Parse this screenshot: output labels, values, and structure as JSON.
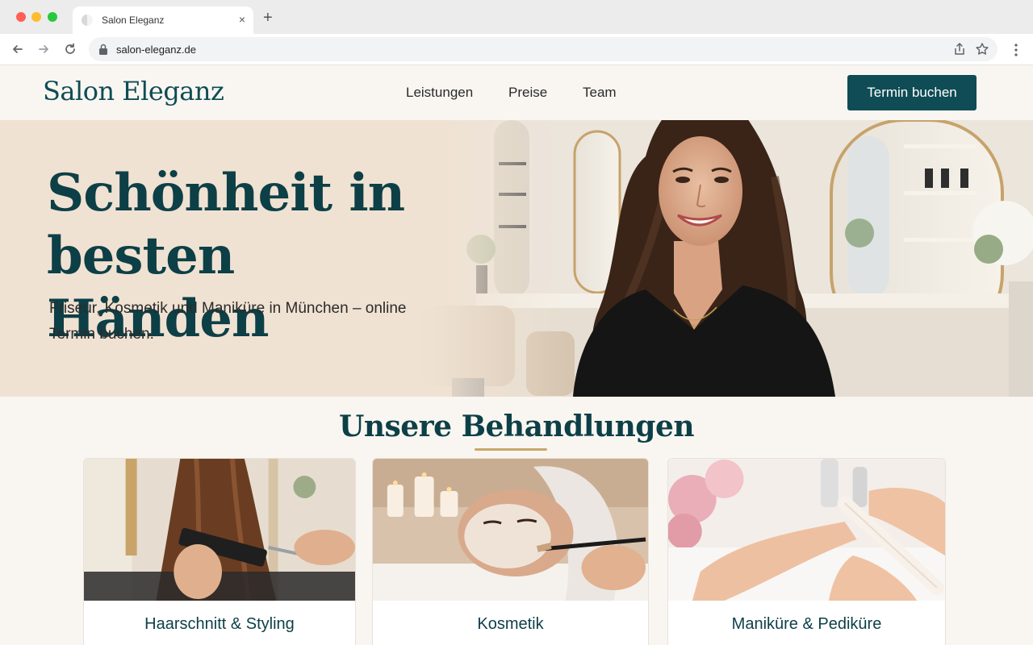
{
  "browser": {
    "tab_title": "Salon Eleganz",
    "tab_close": "×",
    "new_tab": "+",
    "url": "salon-eleganz.de"
  },
  "header": {
    "logo": "Salon Eleganz",
    "nav": [
      "Leistungen",
      "Preise",
      "Team"
    ],
    "cta": "Termin buchen"
  },
  "hero": {
    "title": "Schönheit in besten Händen",
    "subtitle": "Friseur, Kosmetik und Maniküre in München – online Termin buchen."
  },
  "treatments": {
    "title": "Unsere Behandlungen",
    "cards": [
      {
        "label": "Haarschnitt & Styling"
      },
      {
        "label": "Kosmetik"
      },
      {
        "label": "Maniküre & Pediküre"
      }
    ]
  },
  "colors": {
    "brand": "#0f4c55",
    "accent": "#c9a86a",
    "background": "#f9f6f1"
  },
  "icons": [
    "back-icon",
    "forward-icon",
    "reload-icon",
    "lock-icon",
    "share-icon",
    "star-icon",
    "menu-icon"
  ]
}
